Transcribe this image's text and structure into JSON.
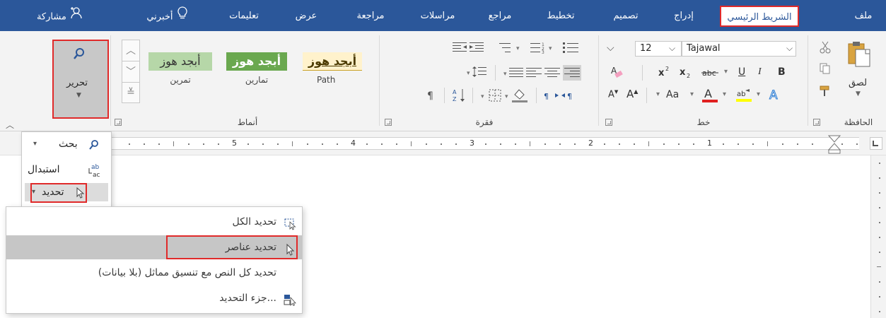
{
  "tabs": {
    "file": "ملف",
    "home": "الشريط الرئيسي",
    "insert": "إدراج",
    "design": "تصميم",
    "layout": "تخطيط",
    "references": "مراجع",
    "mailings": "مراسلات",
    "review": "مراجعة",
    "view": "عرض",
    "help": "تعليمات",
    "tell_me": "أخبرني",
    "share": "مشاركة"
  },
  "clipboard": {
    "group_label": "الحافظة",
    "paste_label": "لصق"
  },
  "font": {
    "group_label": "خط",
    "font_name": "Tajawal",
    "font_size": "12",
    "bold": "B",
    "italic": "I",
    "underline": "U",
    "change_case": "Aa",
    "grow": "A",
    "shrink": "A"
  },
  "paragraph": {
    "group_label": "فقرة"
  },
  "styles": {
    "group_label": "أنماط",
    "items": [
      {
        "sample": "أبجد هوز",
        "name": "Path"
      },
      {
        "sample": "أبجد هوز",
        "name": "تمارين"
      },
      {
        "sample": "أبجد هوز",
        "name": "تمرين"
      }
    ]
  },
  "editing": {
    "label": "تحرير"
  },
  "ruler": {
    "numbers": [
      "1",
      "2",
      "3",
      "4",
      "5"
    ]
  },
  "edit_menu": {
    "find": "بحث",
    "replace": "استبدال",
    "select": "تحديد"
  },
  "select_menu": {
    "select_all": "تحديد الكل",
    "select_objects": "تحديد عناصر",
    "select_similar": "تحديد كل النص مع تنسيق مماثل (بلا بيانات)",
    "selection_pane": "جزء التحديد..."
  },
  "colors": {
    "tab_bar": "#2b579a",
    "highlight_box": "#e02a2a",
    "menu_hover": "#c6c6c6",
    "style_path_bg": "#fff2cc",
    "style_tamarin_bg": "#6aa84f",
    "style_tamreen_bg": "#b6d7a8"
  }
}
